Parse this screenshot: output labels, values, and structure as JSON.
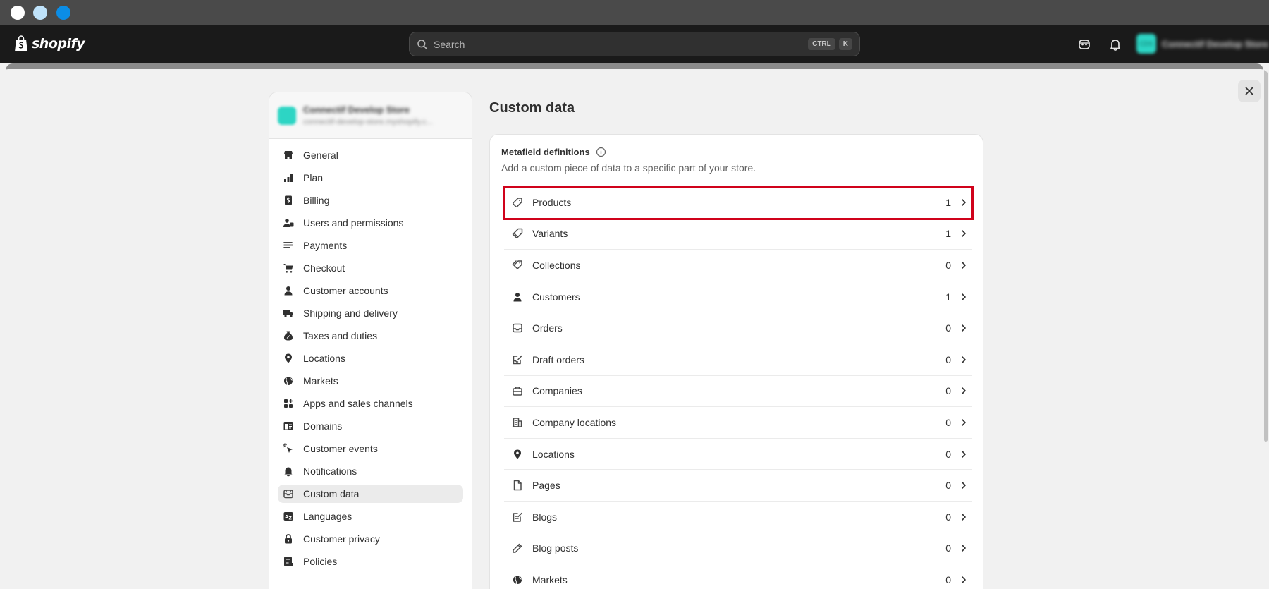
{
  "window": {
    "traffic_lights": [
      "close",
      "minimize",
      "maximize"
    ]
  },
  "topbar": {
    "brand": "shopify",
    "search_placeholder": "Search",
    "shortcut": [
      "CTRL",
      "K"
    ],
    "store_initials": "CDS",
    "store_name": "Connectif Develop Store"
  },
  "sidebar": {
    "store_name": "Connectif Develop Store",
    "store_domain": "connectif-develop-store.myshopify.c...",
    "items": [
      {
        "label": "General",
        "icon": "store-icon"
      },
      {
        "label": "Plan",
        "icon": "plan-icon"
      },
      {
        "label": "Billing",
        "icon": "billing-icon"
      },
      {
        "label": "Users and permissions",
        "icon": "users-icon"
      },
      {
        "label": "Payments",
        "icon": "payments-icon"
      },
      {
        "label": "Checkout",
        "icon": "cart-icon"
      },
      {
        "label": "Customer accounts",
        "icon": "person-icon"
      },
      {
        "label": "Shipping and delivery",
        "icon": "truck-icon"
      },
      {
        "label": "Taxes and duties",
        "icon": "tax-icon"
      },
      {
        "label": "Locations",
        "icon": "location-icon"
      },
      {
        "label": "Markets",
        "icon": "globe-icon"
      },
      {
        "label": "Apps and sales channels",
        "icon": "apps-icon"
      },
      {
        "label": "Domains",
        "icon": "domains-icon"
      },
      {
        "label": "Customer events",
        "icon": "cursor-icon"
      },
      {
        "label": "Notifications",
        "icon": "bell-icon"
      },
      {
        "label": "Custom data",
        "icon": "database-icon",
        "active": true
      },
      {
        "label": "Languages",
        "icon": "language-icon"
      },
      {
        "label": "Customer privacy",
        "icon": "lock-icon"
      },
      {
        "label": "Policies",
        "icon": "policies-icon"
      }
    ]
  },
  "main": {
    "title": "Custom data",
    "card": {
      "title": "Metafield definitions",
      "subtitle": "Add a custom piece of data to a specific part of your store.",
      "rows": [
        {
          "label": "Products",
          "count": "1",
          "icon": "tag-icon",
          "highlighted": true
        },
        {
          "label": "Variants",
          "count": "1",
          "icon": "variants-icon"
        },
        {
          "label": "Collections",
          "count": "0",
          "icon": "collections-icon"
        },
        {
          "label": "Customers",
          "count": "1",
          "icon": "person-icon"
        },
        {
          "label": "Orders",
          "count": "0",
          "icon": "inbox-icon"
        },
        {
          "label": "Draft orders",
          "count": "0",
          "icon": "draft-order-icon"
        },
        {
          "label": "Companies",
          "count": "0",
          "icon": "briefcase-icon"
        },
        {
          "label": "Company locations",
          "count": "0",
          "icon": "building-icon"
        },
        {
          "label": "Locations",
          "count": "0",
          "icon": "location-icon"
        },
        {
          "label": "Pages",
          "count": "0",
          "icon": "page-icon"
        },
        {
          "label": "Blogs",
          "count": "0",
          "icon": "blog-icon"
        },
        {
          "label": "Blog posts",
          "count": "0",
          "icon": "pencil-icon"
        },
        {
          "label": "Markets",
          "count": "0",
          "icon": "globe-icon"
        }
      ]
    }
  },
  "colors": {
    "highlight": "#d0021b",
    "topbar": "#1a1a1a",
    "accent_teal": "#2dd5c4"
  }
}
